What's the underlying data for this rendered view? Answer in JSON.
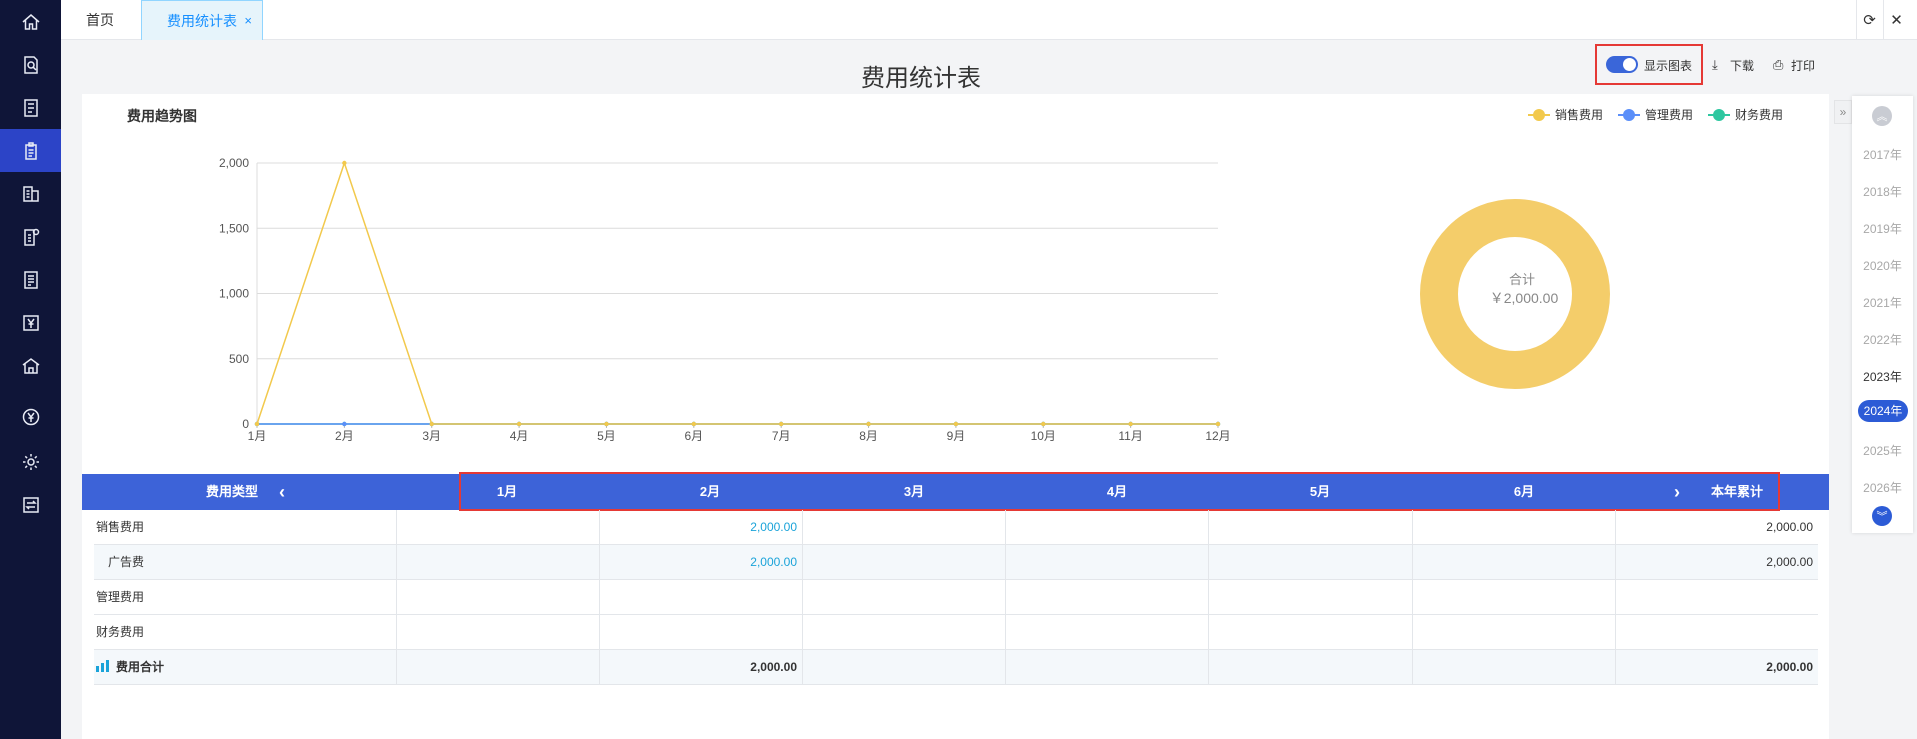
{
  "tabs": {
    "home": "首页",
    "active": "费用统计表",
    "close": "×"
  },
  "page": {
    "title": "费用统计表"
  },
  "tools": {
    "show_chart": "显示图表",
    "download": "下载",
    "print": "打印"
  },
  "chart": {
    "title": "费用趋势图",
    "legend": [
      "销售费用",
      "管理费用",
      "财务费用"
    ]
  },
  "chart_data": {
    "type": "line",
    "title": "费用趋势图",
    "x": [
      "1月",
      "2月",
      "3月",
      "4月",
      "5月",
      "6月",
      "7月",
      "8月",
      "9月",
      "10月",
      "11月",
      "12月"
    ],
    "ylim": [
      0,
      2000
    ],
    "yticks": [
      "0",
      "500",
      "1,000",
      "1,500",
      "2,000"
    ],
    "ytick_values": [
      0,
      500,
      1000,
      1500,
      2000
    ],
    "grid": true,
    "legend_position": "top-right",
    "series": [
      {
        "name": "销售费用",
        "color": "#f2c94c",
        "values": [
          0,
          2000,
          0,
          0,
          0,
          0,
          0,
          0,
          0,
          0,
          0,
          0
        ]
      },
      {
        "name": "管理费用",
        "color": "#5b8ff9",
        "values": [
          0,
          0,
          0,
          0,
          0,
          0,
          0,
          0,
          0,
          0,
          0,
          0
        ]
      },
      {
        "name": "财务费用",
        "color": "#2ec7a0",
        "values": [
          0,
          0,
          0,
          0,
          0,
          0,
          0,
          0,
          0,
          0,
          0,
          0
        ]
      }
    ],
    "donut": {
      "label": "合计",
      "value_text": "￥2,000.00",
      "slices": [
        {
          "name": "销售费用",
          "value": 2000,
          "color": "#f4cd6a"
        }
      ]
    }
  },
  "years": {
    "items": [
      "2017年",
      "2018年",
      "2019年",
      "2020年",
      "2021年",
      "2022年",
      "2023年",
      "2024年",
      "2025年",
      "2026年"
    ],
    "active": "2024年",
    "prev_icon": "chevron-double-up-icon",
    "next_icon": "chevron-double-down-icon"
  },
  "table": {
    "type_header": "费用类型",
    "prev": "‹",
    "next": "›",
    "months": [
      "1月",
      "2月",
      "3月",
      "4月",
      "5月",
      "6月"
    ],
    "total_header": "本年累计",
    "rows": [
      {
        "label": "销售费用",
        "indent": false,
        "values": [
          "",
          "2,000.00",
          "",
          "",
          "",
          ""
        ],
        "total": "2,000.00"
      },
      {
        "label": "广告费",
        "indent": true,
        "values": [
          "",
          "2,000.00",
          "",
          "",
          "",
          ""
        ],
        "total": "2,000.00"
      },
      {
        "label": "管理费用",
        "indent": false,
        "values": [
          "",
          "",
          "",
          "",
          "",
          ""
        ],
        "total": ""
      },
      {
        "label": "财务费用",
        "indent": false,
        "values": [
          "",
          "",
          "",
          "",
          "",
          ""
        ],
        "total": ""
      }
    ],
    "sum_row": {
      "label": "费用合计",
      "values": [
        "",
        "2,000.00",
        "",
        "",
        "",
        ""
      ],
      "total": "2,000.00"
    }
  },
  "colors": {
    "sidebar": "#0f1538",
    "accent": "#2c44c7",
    "header": "#3d63d8",
    "link": "#1aa3d9"
  }
}
